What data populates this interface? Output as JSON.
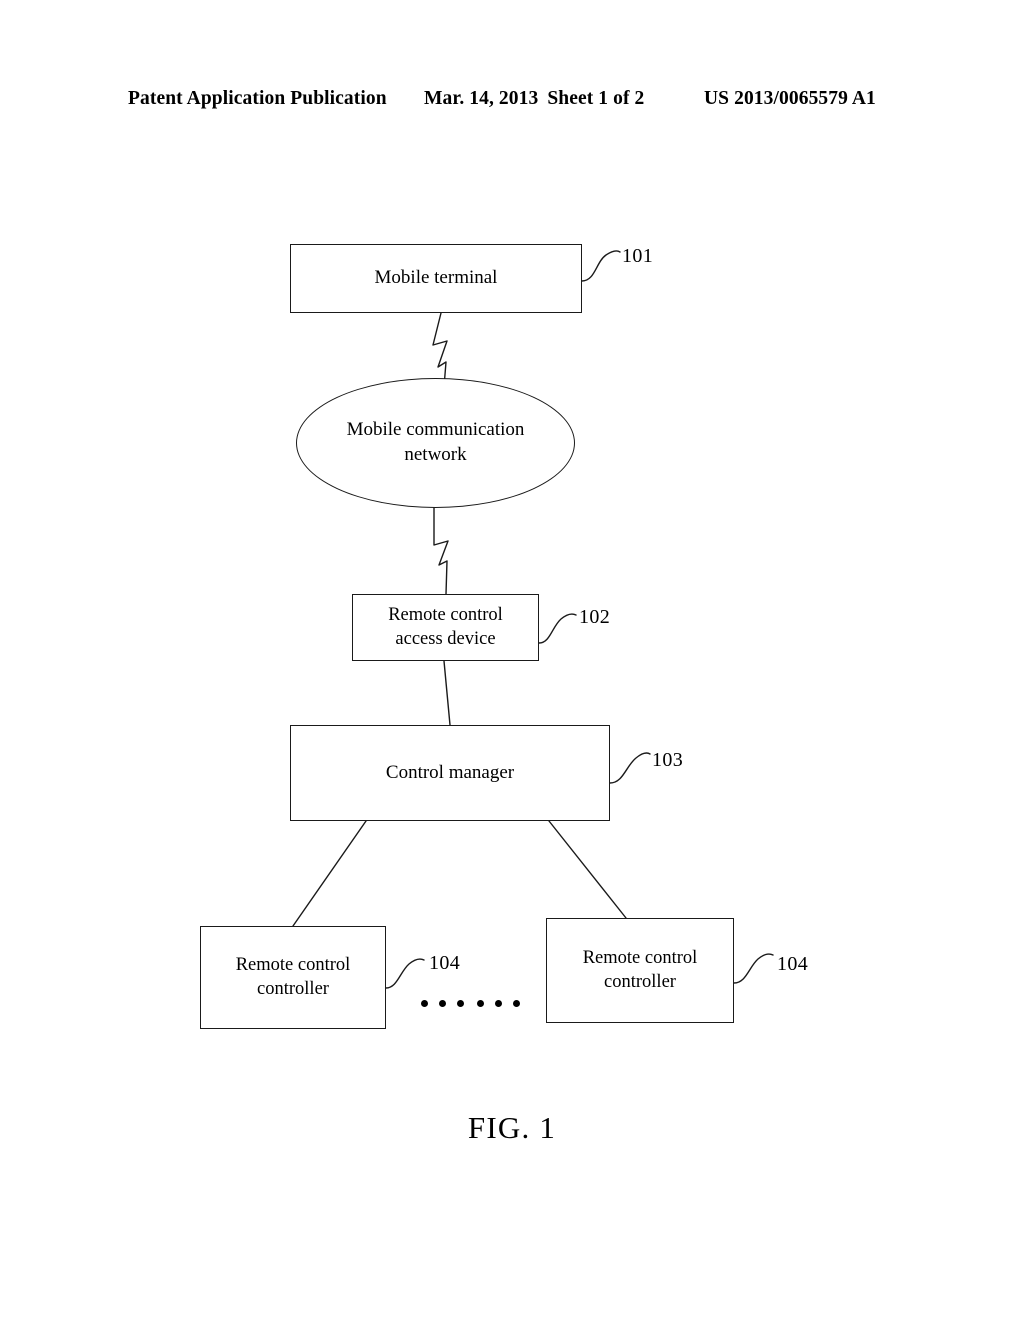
{
  "header": {
    "left": "Patent Application Publication",
    "date": "Mar. 14, 2013",
    "sheet": "Sheet 1 of 2",
    "publication_number": "US 2013/0065579 A1"
  },
  "figure": {
    "caption": "FIG. 1",
    "nodes": {
      "mobile_terminal": {
        "label": "Mobile terminal",
        "ref": "101",
        "shape": "rectangle"
      },
      "mobile_network": {
        "label": "Mobile communication\nnetwork",
        "ref": "",
        "shape": "ellipse"
      },
      "access_device": {
        "label": "Remote control\naccess device",
        "ref": "102",
        "shape": "rectangle"
      },
      "control_manager": {
        "label": "Control manager",
        "ref": "103",
        "shape": "rectangle"
      },
      "controller_left": {
        "label": "Remote control\ncontroller",
        "ref": "104",
        "shape": "rectangle"
      },
      "controller_right": {
        "label": "Remote control\ncontroller",
        "ref": "104",
        "shape": "rectangle"
      }
    },
    "ellipsis": {
      "left": "...",
      "right": "..."
    }
  },
  "colors": {
    "ink": "#1a1a1a",
    "page": "#ffffff"
  }
}
